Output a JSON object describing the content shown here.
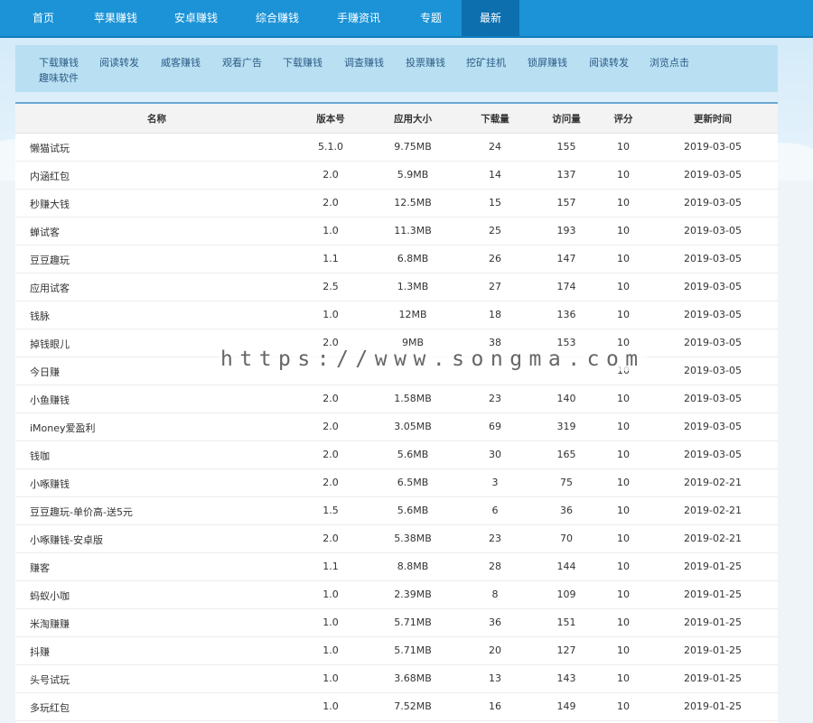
{
  "nav": [
    "首页",
    "苹果赚钱",
    "安卓赚钱",
    "综合赚钱",
    "手赚资讯",
    "专题",
    "最新"
  ],
  "subnav": [
    "下载赚钱",
    "阅读转发",
    "威客赚钱",
    "观看广告",
    "下载赚钱",
    "调查赚钱",
    "投票赚钱",
    "挖矿挂机",
    "锁屏赚钱",
    "阅读转发",
    "浏览点击",
    "趣味软件"
  ],
  "table": {
    "headers": {
      "name": "名称",
      "version": "版本号",
      "size": "应用大小",
      "downloads": "下载量",
      "visits": "访问量",
      "score": "评分",
      "time": "更新时间"
    },
    "rows": [
      {
        "name": "懒猫试玩",
        "version": "5.1.0",
        "size": "9.75MB",
        "downloads": "24",
        "visits": "155",
        "score": "10",
        "time": "2019-03-05"
      },
      {
        "name": "内涵红包",
        "version": "2.0",
        "size": "5.9MB",
        "downloads": "14",
        "visits": "137",
        "score": "10",
        "time": "2019-03-05"
      },
      {
        "name": "秒赚大钱",
        "version": "2.0",
        "size": "12.5MB",
        "downloads": "15",
        "visits": "157",
        "score": "10",
        "time": "2019-03-05"
      },
      {
        "name": "蝉试客",
        "version": "1.0",
        "size": "11.3MB",
        "downloads": "25",
        "visits": "193",
        "score": "10",
        "time": "2019-03-05"
      },
      {
        "name": "豆豆趣玩",
        "version": "1.1",
        "size": "6.8MB",
        "downloads": "26",
        "visits": "147",
        "score": "10",
        "time": "2019-03-05"
      },
      {
        "name": "应用试客",
        "version": "2.5",
        "size": "1.3MB",
        "downloads": "27",
        "visits": "174",
        "score": "10",
        "time": "2019-03-05"
      },
      {
        "name": "钱脉",
        "version": "1.0",
        "size": "12MB",
        "downloads": "18",
        "visits": "136",
        "score": "10",
        "time": "2019-03-05"
      },
      {
        "name": "掉钱眼儿",
        "version": "2.0",
        "size": "9MB",
        "downloads": "38",
        "visits": "153",
        "score": "10",
        "time": "2019-03-05"
      },
      {
        "name": "今日赚",
        "version": "",
        "size": "",
        "downloads": "",
        "visits": "",
        "score": "10",
        "time": "2019-03-05"
      },
      {
        "name": "小鱼赚钱",
        "version": "2.0",
        "size": "1.58MB",
        "downloads": "23",
        "visits": "140",
        "score": "10",
        "time": "2019-03-05"
      },
      {
        "name": "iMoney爱盈利",
        "version": "2.0",
        "size": "3.05MB",
        "downloads": "69",
        "visits": "319",
        "score": "10",
        "time": "2019-03-05"
      },
      {
        "name": "钱咖",
        "version": "2.0",
        "size": "5.6MB",
        "downloads": "30",
        "visits": "165",
        "score": "10",
        "time": "2019-03-05"
      },
      {
        "name": "小啄赚钱",
        "version": "2.0",
        "size": "6.5MB",
        "downloads": "3",
        "visits": "75",
        "score": "10",
        "time": "2019-02-21"
      },
      {
        "name": "豆豆趣玩-单价高-送5元",
        "version": "1.5",
        "size": "5.6MB",
        "downloads": "6",
        "visits": "36",
        "score": "10",
        "time": "2019-02-21"
      },
      {
        "name": "小啄赚钱-安卓版",
        "version": "2.0",
        "size": "5.38MB",
        "downloads": "23",
        "visits": "70",
        "score": "10",
        "time": "2019-02-21"
      },
      {
        "name": "赚客",
        "version": "1.1",
        "size": "8.8MB",
        "downloads": "28",
        "visits": "144",
        "score": "10",
        "time": "2019-01-25"
      },
      {
        "name": "蚂蚁小咖",
        "version": "1.0",
        "size": "2.39MB",
        "downloads": "8",
        "visits": "109",
        "score": "10",
        "time": "2019-01-25"
      },
      {
        "name": "米淘赚赚",
        "version": "1.0",
        "size": "5.71MB",
        "downloads": "36",
        "visits": "151",
        "score": "10",
        "time": "2019-01-25"
      },
      {
        "name": "抖赚",
        "version": "1.0",
        "size": "5.71MB",
        "downloads": "20",
        "visits": "127",
        "score": "10",
        "time": "2019-01-25"
      },
      {
        "name": "头号试玩",
        "version": "1.0",
        "size": "3.68MB",
        "downloads": "13",
        "visits": "143",
        "score": "10",
        "time": "2019-01-25"
      },
      {
        "name": "多玩红包",
        "version": "1.0",
        "size": "7.52MB",
        "downloads": "16",
        "visits": "149",
        "score": "10",
        "time": "2019-01-25"
      }
    ]
  },
  "watermark": "https://www.songma.com"
}
